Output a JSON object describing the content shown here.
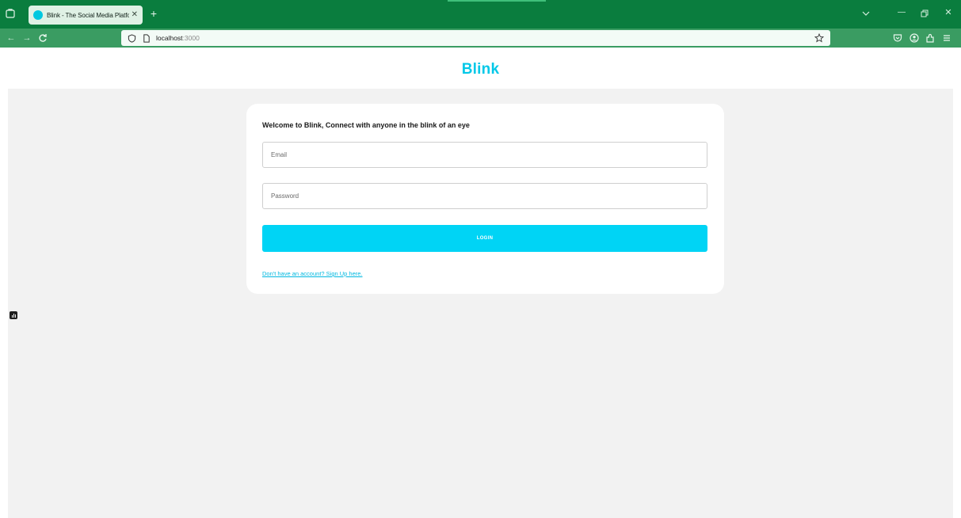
{
  "browser": {
    "tab": {
      "title": "Blink - The Social Media Platfor"
    },
    "url": {
      "host": "localhost",
      "port": ":3000"
    }
  },
  "page": {
    "brand": "Blink",
    "welcome": "Welcome to Blink, Connect with anyone in the blink of an eye",
    "email": {
      "placeholder": "Email",
      "value": ""
    },
    "password": {
      "placeholder": "Password",
      "value": ""
    },
    "login_label": "LOGIN",
    "signup_link": "Don't have an account? Sign Up here."
  },
  "colors": {
    "browser_tabbar": "#0a7d3e",
    "browser_toolbar": "#3a9c62",
    "brand": "#00c8e8",
    "button": "#00d4f5",
    "page_bg": "#f2f2f2"
  },
  "icons": {
    "tab_overview": "tab-overview-icon",
    "favicon": "blink-favicon-icon",
    "tab_close": "close-icon",
    "new_tab": "plus-icon",
    "tab_list": "chevron-down-icon",
    "back": "arrow-left-icon",
    "forward": "arrow-right-icon",
    "reload": "reload-icon",
    "tracking_protection": "shield-icon",
    "page_info": "page-icon",
    "bookmark": "star-icon",
    "pocket": "pocket-icon",
    "account": "account-icon",
    "extensions": "extensions-icon",
    "menu": "hamburger-menu-icon",
    "devtools": "devtools-badge-icon"
  }
}
